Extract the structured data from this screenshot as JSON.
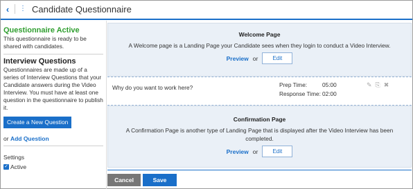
{
  "header": {
    "title": "Candidate Questionnaire",
    "back_icon": "‹",
    "menu_icon": "⋮"
  },
  "left": {
    "status_title": "Questionnaire Active",
    "status_desc": "This questionnaire is ready to be shared with candidates.",
    "section_title": "Interview Questions",
    "section_desc": "Questionnaires are made up of a series of Interview Questions that your Candidate answers during the Video Interview. You must have at least one question in the questionnaire to publish it.",
    "create_button": "Create a New Question",
    "or_text": "or",
    "add_question_link": "Add Question",
    "settings_label": "Settings",
    "active_label": "Active",
    "active_checked": true
  },
  "welcome": {
    "title": "Welcome Page",
    "desc": "A Welcome page is a Landing Page your Candidate sees when they login to conduct a Video Interview.",
    "preview": "Preview",
    "or": "or",
    "edit": "Edit"
  },
  "question": {
    "text": "Why do you want to work here?",
    "prep_label": "Prep Time:",
    "prep_value": "05:00",
    "response_label": "Response Time:",
    "response_value": "02:00",
    "icons": [
      "edit-icon",
      "copy-icon",
      "delete-icon"
    ]
  },
  "confirmation": {
    "title": "Confirmation Page",
    "desc": "A Confirmation Page is another type of Landing Page that is displayed after the Video Interview has been completed.",
    "preview": "Preview",
    "or": "or",
    "edit": "Edit"
  },
  "footer": {
    "cancel": "Cancel",
    "save": "Save"
  },
  "colors": {
    "accent": "#1a6fc9",
    "active_green": "#2f9e2f",
    "panel_bg": "#eaf0f7"
  }
}
